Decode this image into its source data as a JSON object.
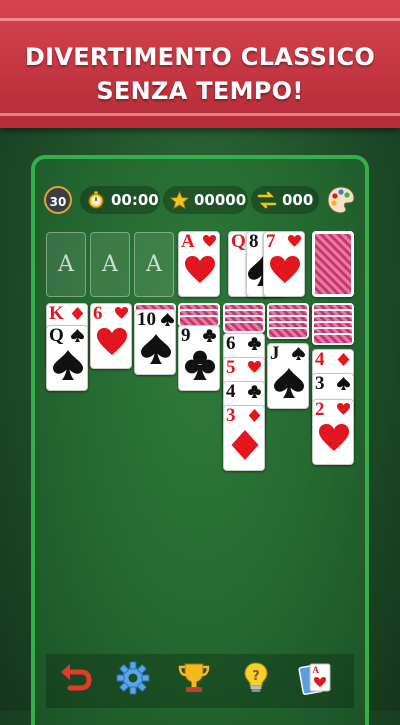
{
  "banner": {
    "line1": "DIVERTIMENTO CLASSICO",
    "line2": "SENZA TEMPO!"
  },
  "status": {
    "level": "30",
    "time": "00:00",
    "score": "00000",
    "moves": "000"
  },
  "foundation": [
    "A",
    "A",
    "A"
  ],
  "colors": {
    "red": "#e3161f",
    "black": "#111111",
    "accent_green": "#34b04a"
  },
  "cards": {
    "ace_hearts": "A",
    "waste_q": "Q",
    "waste_8": "8",
    "waste_7": "7",
    "t1_k": "K",
    "t1_q": "Q",
    "t2_6": "6",
    "t3_10": "10",
    "t4_9": "9",
    "t5_6": "6",
    "t5_5": "5",
    "t5_4": "4",
    "t5_3": "3",
    "t6_j": "J",
    "t7_4": "4",
    "t7_3": "3",
    "t7_2": "2"
  },
  "toolbar": [
    "undo-icon",
    "settings-gear-icon",
    "trophy-icon",
    "hint-bulb-icon",
    "new-game-cards-icon"
  ]
}
